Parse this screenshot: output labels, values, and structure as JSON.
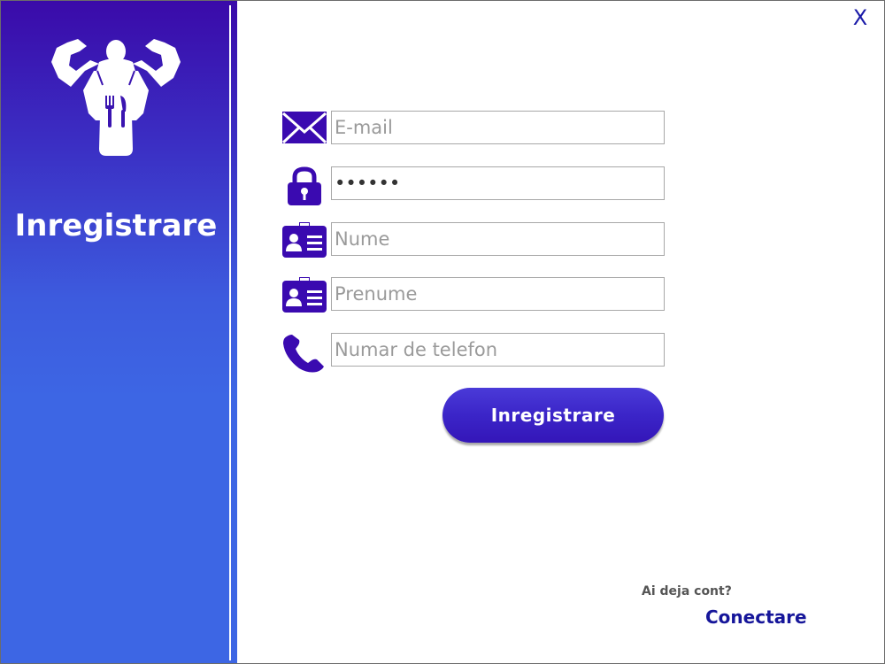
{
  "window": {
    "close_label": "X"
  },
  "sidebar": {
    "title": "Inregistrare",
    "logo_icon": "bodybuilder-chef-icon"
  },
  "form": {
    "fields": [
      {
        "name": "email",
        "icon": "envelope-icon",
        "placeholder": "E-mail",
        "value": ""
      },
      {
        "name": "password",
        "icon": "padlock-icon",
        "placeholder": "",
        "value": "••••••"
      },
      {
        "name": "last-name",
        "icon": "id-card-icon",
        "placeholder": "Nume",
        "value": ""
      },
      {
        "name": "first-name",
        "icon": "id-card-icon",
        "placeholder": "Prenume",
        "value": ""
      },
      {
        "name": "phone",
        "icon": "phone-icon",
        "placeholder": "Numar de telefon",
        "value": ""
      }
    ],
    "submit_label": "Inregistrare"
  },
  "footer": {
    "question": "Ai deja cont?",
    "login_label": "Conectare"
  },
  "colors": {
    "accent": "#3a0ab0",
    "sidebar_top": "#3a0aa9",
    "sidebar_bottom": "#3d66e4",
    "link": "#16169a"
  }
}
